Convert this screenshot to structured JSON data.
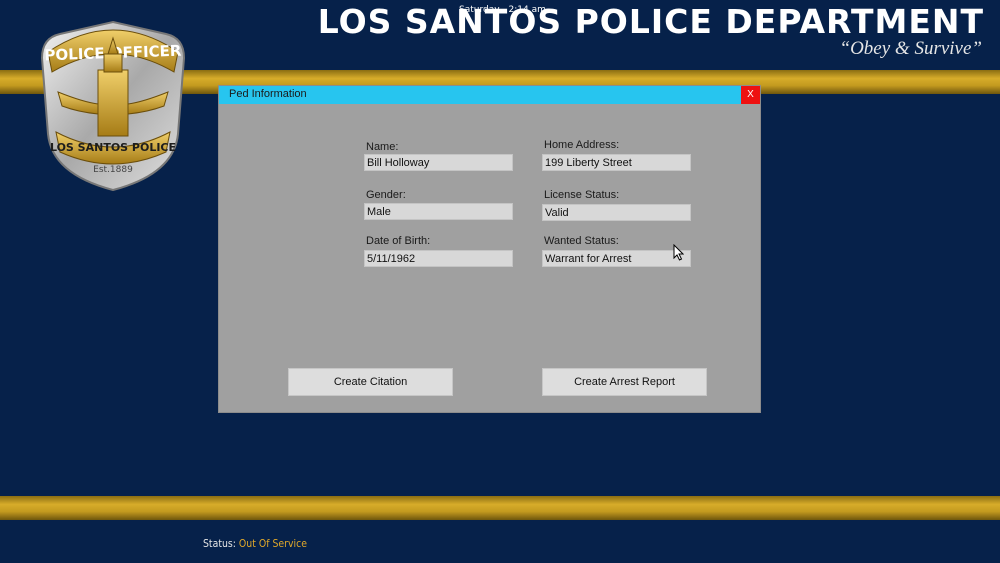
{
  "header": {
    "clock": "Saturday - 2:14 am",
    "title": "LOS SANTOS POLICE DEPARTMENT",
    "motto": "“Obey & Survive”"
  },
  "badge": {
    "top_text": "POLICE OFFICER",
    "bottom_text": "LOS SANTOS POLICE",
    "est": "Est.1889"
  },
  "dialog": {
    "title": "Ped Information",
    "close_label": "X",
    "fields": {
      "name": {
        "label": "Name:",
        "value": "Bill Holloway"
      },
      "home_address": {
        "label": "Home Address:",
        "value": "199 Liberty Street"
      },
      "gender": {
        "label": "Gender:",
        "value": "Male"
      },
      "license_status": {
        "label": "License Status:",
        "value": "Valid"
      },
      "dob": {
        "label": "Date of Birth:",
        "value": "5/11/1962"
      },
      "wanted_status": {
        "label": "Wanted Status:",
        "value": "Warrant for Arrest"
      }
    },
    "buttons": {
      "create_citation": "Create Citation",
      "create_arrest_report": "Create Arrest Report"
    }
  },
  "status_bar": {
    "label": "Status:",
    "value": "Out Of Service"
  },
  "colors": {
    "background": "#06214a",
    "gold_stripe": "#c39a1f",
    "dialog_titlebar": "#27c5ef",
    "dialog_body": "#a0a0a0",
    "close_button": "#ee1111",
    "status_value": "#e0a82a"
  }
}
